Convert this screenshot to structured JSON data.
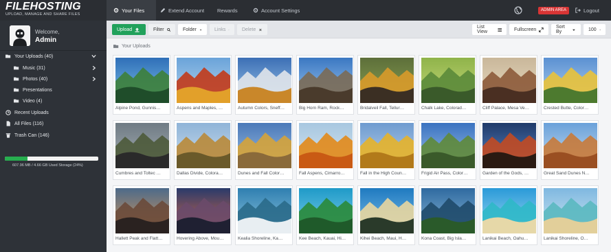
{
  "brand": {
    "name": "FILEHOSTING",
    "tagline": "UPLOAD, MANAGE AND SHARE FILES"
  },
  "nav": {
    "files": "Your Files",
    "extend": "Extend Account",
    "rewards": "Rewards",
    "settings": "Account Settings",
    "admin_area": "ADMIN AREA",
    "logout": "Logout"
  },
  "user": {
    "welcome": "Welcome,",
    "name": "Admin"
  },
  "sidebar": {
    "items": [
      {
        "label": "Your Uploads (40)",
        "icon": "folder-open-icon"
      },
      {
        "label": "Music (31)",
        "icon": "folder-icon"
      },
      {
        "label": "Photos (40)",
        "icon": "folder-icon"
      },
      {
        "label": "Presentations",
        "icon": "folder-icon"
      },
      {
        "label": "Video (4)",
        "icon": "folder-icon"
      },
      {
        "label": "Recent Uploads",
        "icon": "clock-icon"
      },
      {
        "label": "All Files (116)",
        "icon": "file-icon"
      },
      {
        "label": "Trash Can (146)",
        "icon": "trash-icon"
      }
    ],
    "storage": {
      "text": "607.96 MB / 4.66 GB Used Storage (24%)",
      "percent": 24
    }
  },
  "toolbar": {
    "upload": "Upload",
    "filter": "Filter",
    "folder": "Folder",
    "links": "Links",
    "delete": "Delete",
    "list_view": "List View",
    "fullscreen": "Fullscreen",
    "sort_by": "Sort By",
    "per_page": "100"
  },
  "breadcrumb": "Your Uploads",
  "files": [
    "Alpine Pond, Gunnis…",
    "Aspens and Maples, …",
    "Autumn Colors, Sneff…",
    "Big Horn Ram, Rock…",
    "Bridalveil Fall, Tellur…",
    "Chalk Lake, Colorad…",
    "Cliff Palace, Mesa Ve…",
    "Crested Butte, Color…",
    "Cumbres and Toltec …",
    "Dallas Divide, Colora…",
    "Dunes and Fall Color…",
    "Fall Aspens, Cimarro…",
    "Fall in the High Coun…",
    "Frigid Air Pass, Color…",
    "Garden of the Gods, …",
    "Great Sand Dunes N…",
    "Hallett Peak and Flatt…",
    "Hovering Above, Mou…",
    "Kealia Shoreline, Ka…",
    "Kee Beach, Kauai, Hi…",
    "Kihei Beach, Maui, H…",
    "Kona Coast, Big Isla…",
    "Lanikai Beach, Oahu…",
    "Lanikai Shoreline, O…"
  ],
  "colors": {
    "accent": "#21a15b",
    "admin_badge": "#d83535",
    "topbar": "#2b2e33",
    "sidebar": "#2e3238"
  }
}
